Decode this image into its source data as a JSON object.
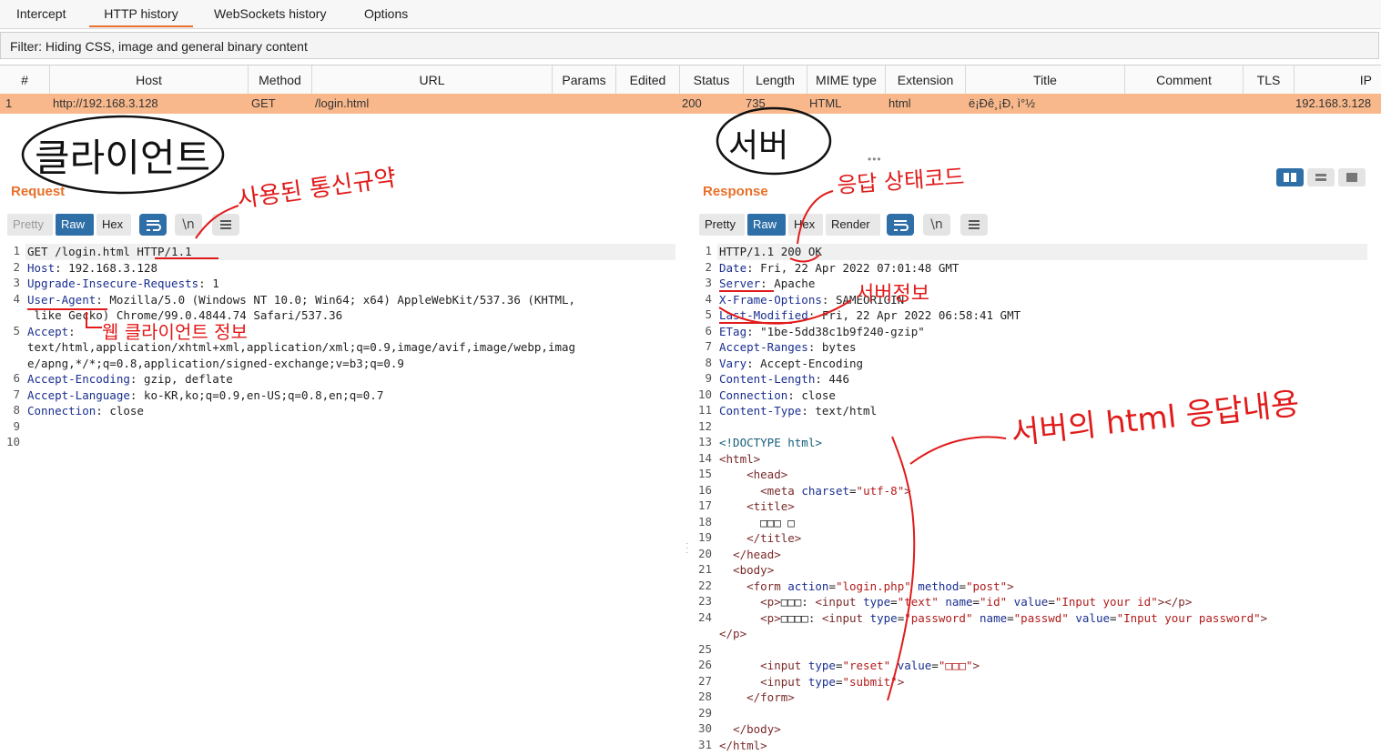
{
  "tabs": [
    {
      "label": "Intercept"
    },
    {
      "label": "HTTP history"
    },
    {
      "label": "WebSockets history"
    },
    {
      "label": "Options"
    }
  ],
  "filter": {
    "text": "Filter: Hiding CSS, image and general binary content"
  },
  "table": {
    "columns": [
      "#",
      "Host",
      "Method",
      "URL",
      "Params",
      "Edited",
      "Status",
      "Length",
      "MIME type",
      "Extension",
      "Title",
      "Comment",
      "TLS",
      "IP"
    ],
    "rows": [
      {
        "num": "1",
        "host": "http://192.168.3.128",
        "method": "GET",
        "url": "/login.html",
        "params": "",
        "edited": "",
        "status": "200",
        "length": "735",
        "mime": "HTML",
        "extension": "html",
        "title": "ë¡Ðê¸¡Ð, ì°½",
        "comment": "",
        "tls": "",
        "ip": "192.168.3.128"
      }
    ]
  },
  "request": {
    "title": "Request",
    "view_buttons": {
      "pretty": "Pretty",
      "raw": "Raw",
      "hex": "Hex",
      "newline": "\\n"
    },
    "lines": [
      {
        "n": "1",
        "text": "GET /login.html HTTP/1.1"
      },
      {
        "n": "2",
        "key": "Host",
        "val": " 192.168.3.128"
      },
      {
        "n": "3",
        "key": "Upgrade-Insecure-Requests",
        "val": " 1"
      },
      {
        "n": "4",
        "key": "User-Agent",
        "val": " Mozilla/5.0 (Windows NT 10.0; Win64; x64) AppleWebKit/537.36 (KHTML,"
      },
      {
        "n": "",
        "text": " like Gecko) Chrome/99.0.4844.74 Safari/537.36"
      },
      {
        "n": "5",
        "key": "Accept",
        "val": ""
      },
      {
        "n": "",
        "text": "text/html,application/xhtml+xml,application/xml;q=0.9,image/avif,image/webp,imag"
      },
      {
        "n": "",
        "text": "e/apng,*/*;q=0.8,application/signed-exchange;v=b3;q=0.9"
      },
      {
        "n": "6",
        "key": "Accept-Encoding",
        "val": " gzip, deflate"
      },
      {
        "n": "7",
        "key": "Accept-Language",
        "val": " ko-KR,ko;q=0.9,en-US;q=0.8,en;q=0.7"
      },
      {
        "n": "8",
        "key": "Connection",
        "val": " close"
      },
      {
        "n": "9",
        "text": ""
      },
      {
        "n": "10",
        "text": ""
      }
    ]
  },
  "response": {
    "title": "Response",
    "view_buttons": {
      "pretty": "Pretty",
      "raw": "Raw",
      "hex": "Hex",
      "render": "Render",
      "newline": "\\n"
    },
    "lines": [
      {
        "n": "1",
        "text": "HTTP/1.1 200 OK"
      },
      {
        "n": "2",
        "key": "Date",
        "val": " Fri, 22 Apr 2022 07:01:48 GMT"
      },
      {
        "n": "3",
        "key": "Server",
        "val": " Apache"
      },
      {
        "n": "4",
        "key": "X-Frame-Options",
        "val": " SAMEORIGIN"
      },
      {
        "n": "5",
        "key": "Last-Modified",
        "val": " Fri, 22 Apr 2022 06:58:41 GMT"
      },
      {
        "n": "6",
        "key": "ETag",
        "val": " \"1be-5dd38c1b9f240-gzip\""
      },
      {
        "n": "7",
        "key": "Accept-Ranges",
        "val": " bytes"
      },
      {
        "n": "8",
        "key": "Vary",
        "val": " Accept-Encoding"
      },
      {
        "n": "9",
        "key": "Content-Length",
        "val": " 446"
      },
      {
        "n": "10",
        "key": "Connection",
        "val": " close"
      },
      {
        "n": "11",
        "key": "Content-Type",
        "val": " text/html"
      },
      {
        "n": "12",
        "text": ""
      },
      {
        "n": "13",
        "html": "<span class=\"dt\">&lt;!DOCTYPE html&gt;</span>"
      },
      {
        "n": "14",
        "html": "<span class=\"tg\">&lt;html&gt;</span>"
      },
      {
        "n": "15",
        "html": "    <span class=\"tg\">&lt;head&gt;</span>"
      },
      {
        "n": "16",
        "html": "      <span class=\"tg\">&lt;meta</span> <span class=\"at\">charset</span>=<span class=\"vl\">\"utf-8\"</span><span class=\"tg\">&gt;</span>"
      },
      {
        "n": "17",
        "html": "    <span class=\"tg\">&lt;title&gt;</span>"
      },
      {
        "n": "18",
        "html": "      □□□ □"
      },
      {
        "n": "19",
        "html": "    <span class=\"tg\">&lt;/title&gt;</span>"
      },
      {
        "n": "20",
        "html": "  <span class=\"tg\">&lt;/head&gt;</span>"
      },
      {
        "n": "21",
        "html": "  <span class=\"tg\">&lt;body&gt;</span>"
      },
      {
        "n": "22",
        "html": "    <span class=\"tg\">&lt;form</span> <span class=\"at\">action</span>=<span class=\"vl\">\"login.php\"</span> <span class=\"at\">method</span>=<span class=\"vl\">\"post\"</span><span class=\"tg\">&gt;</span>"
      },
      {
        "n": "23",
        "html": "      <span class=\"tg\">&lt;p&gt;</span>□□□: <span class=\"tg\">&lt;input</span> <span class=\"at\">type</span>=<span class=\"vl\">\"text\"</span> <span class=\"at\">name</span>=<span class=\"vl\">\"id\"</span> <span class=\"at\">value</span>=<span class=\"vl\">\"Input your id\"</span><span class=\"tg\">&gt;&lt;/p&gt;</span>"
      },
      {
        "n": "24",
        "html": "      <span class=\"tg\">&lt;p&gt;</span>□□□□: <span class=\"tg\">&lt;input</span> <span class=\"at\">type</span>=<span class=\"vl\">\"password\"</span> <span class=\"at\">name</span>=<span class=\"vl\">\"passwd\"</span> <span class=\"at\">value</span>=<span class=\"vl\">\"Input your password\"</span><span class=\"tg\">&gt;</span>"
      },
      {
        "n": "",
        "html": "<span class=\"tg\">&lt;/p&gt;</span>"
      },
      {
        "n": "25",
        "html": ""
      },
      {
        "n": "26",
        "html": "      <span class=\"tg\">&lt;input</span> <span class=\"at\">type</span>=<span class=\"vl\">\"reset\"</span> <span class=\"at\">value</span>=<span class=\"vl\">\"□□□\"</span><span class=\"tg\">&gt;</span>"
      },
      {
        "n": "27",
        "html": "      <span class=\"tg\">&lt;input</span> <span class=\"at\">type</span>=<span class=\"vl\">\"submit\"</span><span class=\"tg\">&gt;</span>"
      },
      {
        "n": "28",
        "html": "    <span class=\"tg\">&lt;/form&gt;</span>"
      },
      {
        "n": "29",
        "html": ""
      },
      {
        "n": "30",
        "html": "  <span class=\"tg\">&lt;/body&gt;</span>"
      },
      {
        "n": "31",
        "html": "<span class=\"tg\">&lt;/html&gt;</span>"
      }
    ]
  },
  "annotations": {
    "client": "클라이언트",
    "protocol": "사용된 통신규약",
    "web_client_info": "웹 클라이언트 정보",
    "server": "서버",
    "status_code": "응답 상태코드",
    "server_info": "서버정보",
    "html_response": "서버의 html 응답내용"
  },
  "colors": {
    "accent": "#e8702a",
    "row_highlight": "#f8b88b",
    "button_blue": "#2f6fa8",
    "annotation": "#e01b1b"
  }
}
